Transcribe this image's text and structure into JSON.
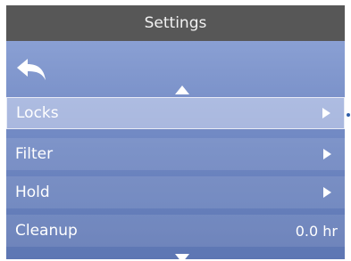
{
  "header": {
    "title": "Settings"
  },
  "menu": {
    "items": [
      {
        "label": "Locks",
        "value": "",
        "has_arrow": true,
        "selected": true
      },
      {
        "label": "Filter",
        "value": "",
        "has_arrow": true,
        "selected": false
      },
      {
        "label": "Hold",
        "value": "",
        "has_arrow": true,
        "selected": false
      },
      {
        "label": "Cleanup",
        "value": "0.0 hr",
        "has_arrow": false,
        "selected": false
      }
    ]
  },
  "icons": {
    "back": "back-arrow-icon",
    "scroll_up": "scroll-up-icon",
    "scroll_down": "scroll-down-icon",
    "submenu": "chevron-right-icon"
  },
  "colors": {
    "header_bg": "#575757",
    "screen_top": "#93a8d9",
    "screen_bottom": "#5d76b3",
    "text": "#ffffff",
    "selection_indicator": "#2f5ea8"
  }
}
